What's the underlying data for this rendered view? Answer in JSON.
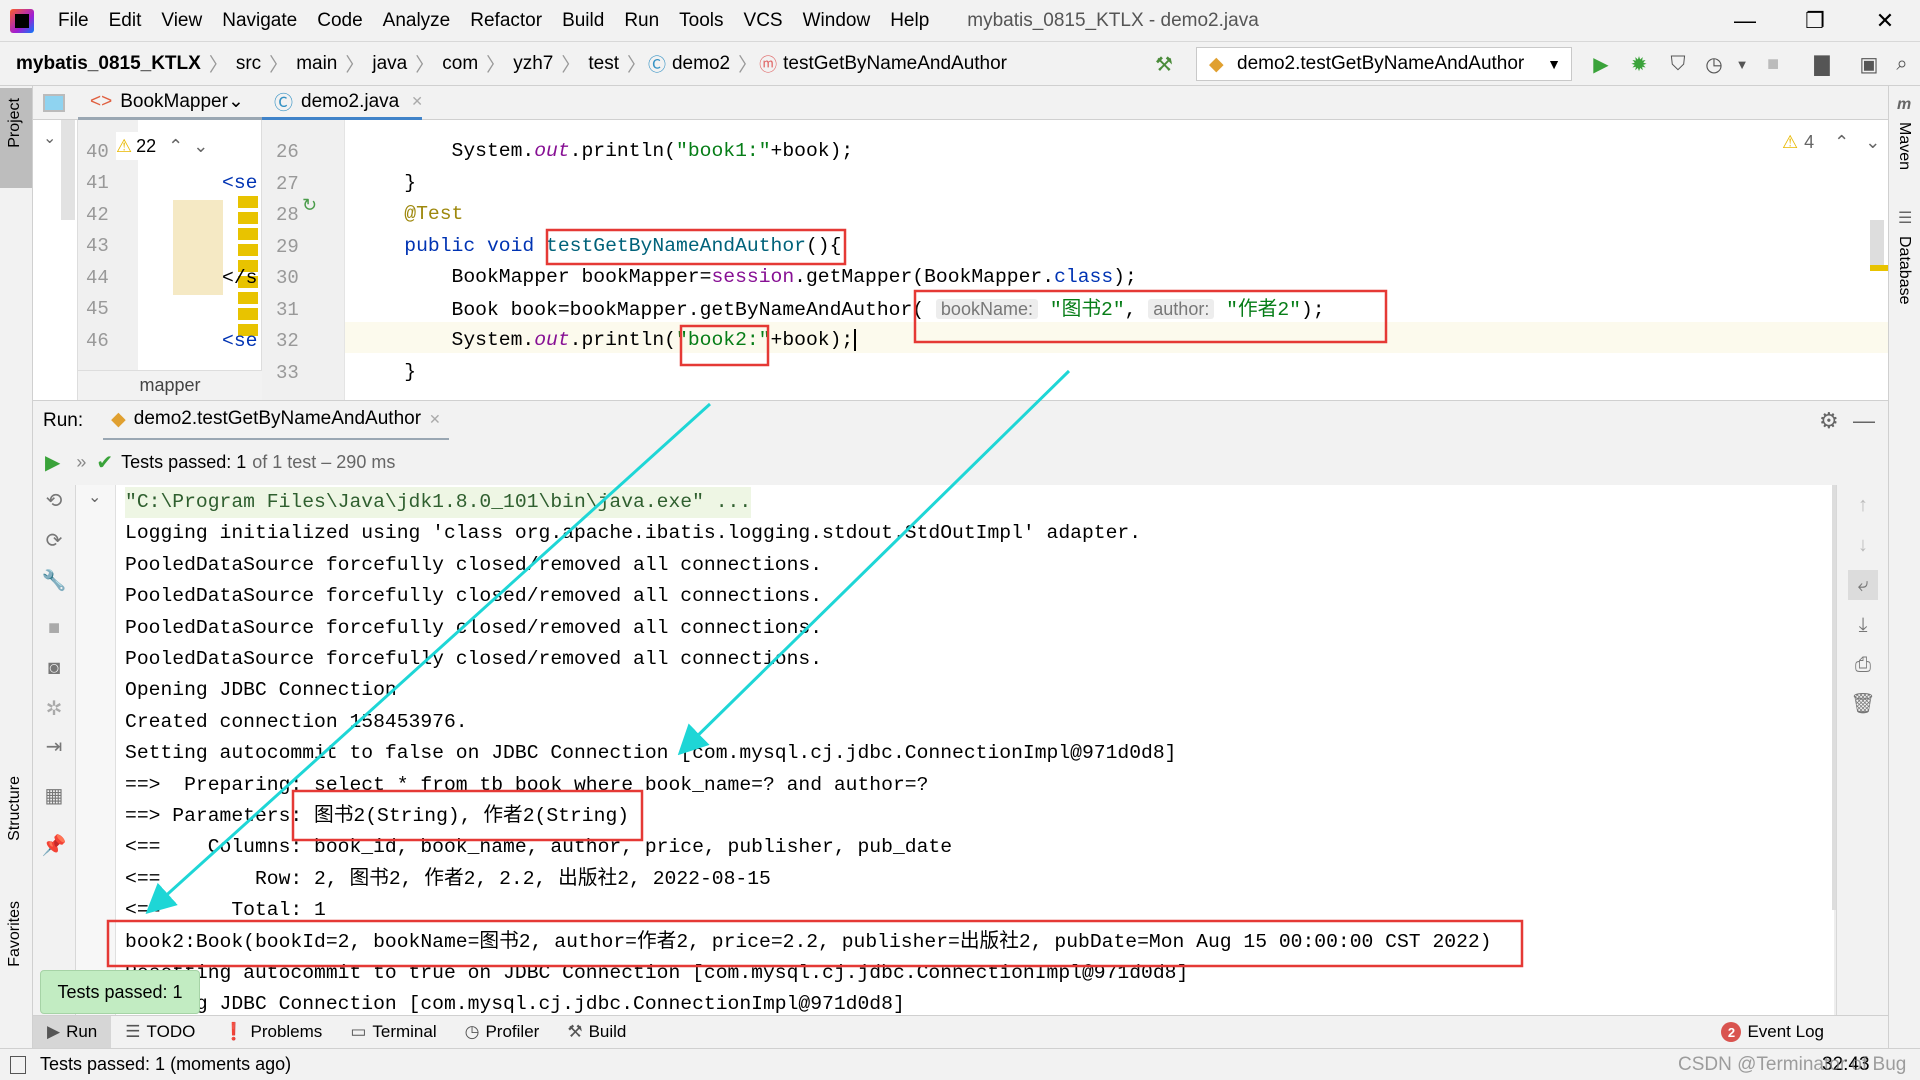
{
  "menubar": {
    "items": [
      "File",
      "Edit",
      "View",
      "Navigate",
      "Code",
      "Analyze",
      "Refactor",
      "Build",
      "Run",
      "Tools",
      "VCS",
      "Window",
      "Help"
    ],
    "window_title": "mybatis_0815_KTLX - demo2.java"
  },
  "navbar": {
    "breadcrumbs": [
      "mybatis_0815_KTLX",
      "src",
      "main",
      "java",
      "com",
      "yzh7",
      "test",
      "demo2",
      "testGetByNameAndAuthor"
    ],
    "run_config": "demo2.testGetByNameAndAuthor"
  },
  "tool_strip_left": {
    "project": "Project",
    "structure": "Structure",
    "favorites": "Favorites"
  },
  "tool_strip_right": {
    "maven": "Maven",
    "database": "Database"
  },
  "editor_tabs": [
    {
      "label": "BookMapper",
      "active": false
    },
    {
      "label": "demo2.java",
      "active": true
    }
  ],
  "xml_editor": {
    "warnings": "22",
    "line_numbers": [
      "40",
      "41",
      "42",
      "43",
      "44",
      "45",
      "46"
    ],
    "snippets": {
      "41": "<se",
      "44": "</s",
      "46": "<se"
    },
    "breadcrumb": "mapper"
  },
  "java_editor": {
    "warnings": "4",
    "lines": [
      {
        "num": "26",
        "tokens": [
          {
            "t": "        System."
          },
          {
            "t": "out",
            "c": "fld"
          },
          {
            "t": ".println("
          },
          {
            "t": "\"book1:\"",
            "c": "str"
          },
          {
            "t": "+book);"
          }
        ]
      },
      {
        "num": "27",
        "tokens": [
          {
            "t": "    }"
          }
        ]
      },
      {
        "num": "28",
        "tokens": [
          {
            "t": "    "
          },
          {
            "t": "@Test",
            "c": "ann"
          }
        ]
      },
      {
        "num": "29",
        "tokens": [
          {
            "t": "    "
          },
          {
            "t": "public void ",
            "c": "kw"
          },
          {
            "t": "testGetByNameAndAuthor",
            "c": "fn"
          },
          {
            "t": "(){"
          }
        ]
      },
      {
        "num": "30",
        "tokens": [
          {
            "t": "        BookMapper bookMapper="
          },
          {
            "t": "session",
            "c": "mem"
          },
          {
            "t": ".getMapper(BookMapper."
          },
          {
            "t": "class",
            "c": "kw"
          },
          {
            "t": ");"
          }
        ]
      },
      {
        "num": "31",
        "tokens": [
          {
            "t": "        Book book=bookMapper.getByNameAndAuthor( "
          },
          {
            "t": "bookName:",
            "c": "hint"
          },
          {
            "t": " "
          },
          {
            "t": "\"图书2\"",
            "c": "str"
          },
          {
            "t": ", "
          },
          {
            "t": "author:",
            "c": "hint"
          },
          {
            "t": " "
          },
          {
            "t": "\"作者2\"",
            "c": "str"
          },
          {
            "t": ");"
          }
        ]
      },
      {
        "num": "32",
        "tokens": [
          {
            "t": "        System."
          },
          {
            "t": "out",
            "c": "fld"
          },
          {
            "t": ".println("
          },
          {
            "t": "\"book2:\"",
            "c": "str"
          },
          {
            "t": "+book);"
          }
        ]
      },
      {
        "num": "33",
        "tokens": [
          {
            "t": "    }"
          }
        ]
      }
    ]
  },
  "run_panel": {
    "label": "Run:",
    "tab": "demo2.testGetByNameAndAuthor",
    "tests_passed": "Tests passed: 1",
    "tests_detail": "of 1 test – 290 ms",
    "console": [
      "\"C:\\Program Files\\Java\\jdk1.8.0_101\\bin\\java.exe\" ...",
      "Logging initialized using 'class org.apache.ibatis.logging.stdout.StdOutImpl' adapter.",
      "PooledDataSource forcefully closed/removed all connections.",
      "PooledDataSource forcefully closed/removed all connections.",
      "PooledDataSource forcefully closed/removed all connections.",
      "PooledDataSource forcefully closed/removed all connections.",
      "Opening JDBC Connection",
      "Created connection 158453976.",
      "Setting autocommit to false on JDBC Connection [com.mysql.cj.jdbc.ConnectionImpl@971d0d8]",
      "==>  Preparing: select * from tb_book where book_name=? and author=?",
      "==> Parameters: 图书2(String), 作者2(String)",
      "<==    Columns: book_id, book_name, author, price, publisher, pub_date",
      "<==        Row: 2, 图书2, 作者2, 2.2, 出版社2, 2022-08-15",
      "<==      Total: 1",
      "book2:Book(bookId=2, bookName=图书2, author=作者2, price=2.2, publisher=出版社2, pubDate=Mon Aug 15 00:00:00 CST 2022)",
      "Resetting autocommit to true on JDBC Connection [com.mysql.cj.jdbc.ConnectionImpl@971d0d8]",
      "Closing JDBC Connection [com.mysql.cj.jdbc.ConnectionImpl@971d0d8]"
    ],
    "tooltip": "Tests passed: 1"
  },
  "tool_windows": {
    "run": "Run",
    "todo": "TODO",
    "problems": "Problems",
    "terminal": "Terminal",
    "profiler": "Profiler",
    "build": "Build",
    "event_log": "Event Log",
    "event_count": "2"
  },
  "status_bar": {
    "message": "Tests passed: 1 (moments ago)",
    "position": "32:43",
    "watermark": "CSDN @Terminator of Bug"
  },
  "colors": {
    "annotation_box": "#e53935",
    "annotation_arrow": "#1ed6d6",
    "success": "#3aa33a"
  }
}
